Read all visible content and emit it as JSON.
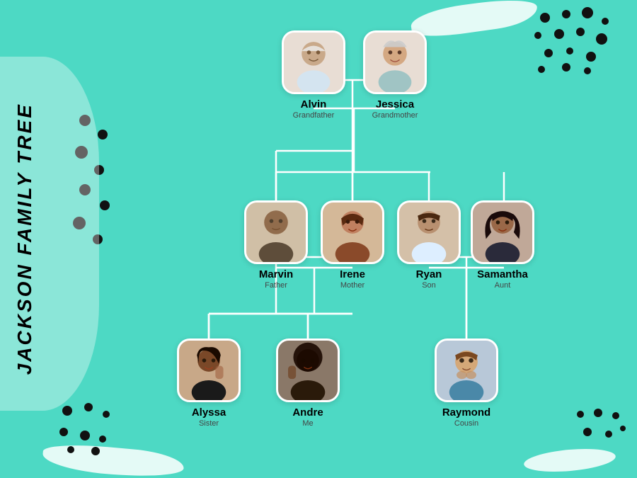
{
  "title": "JACKSON FAMILY TREE",
  "colors": {
    "background": "#4DD9C4",
    "connector": "#ffffff",
    "text_primary": "#000000",
    "text_secondary": "#444444"
  },
  "people": [
    {
      "id": "alvin",
      "name": "Alvin",
      "role": "Grandfather",
      "col": 3,
      "row": 0
    },
    {
      "id": "jessica",
      "name": "Jessica",
      "role": "Grandmother",
      "col": 4,
      "row": 0
    },
    {
      "id": "marvin",
      "name": "Marvin",
      "role": "Father",
      "col": 2,
      "row": 1
    },
    {
      "id": "irene",
      "name": "Irene",
      "role": "Mother",
      "col": 3,
      "row": 1
    },
    {
      "id": "ryan",
      "name": "Ryan",
      "role": "Son",
      "col": 4,
      "row": 1
    },
    {
      "id": "samantha",
      "name": "Samantha",
      "role": "Aunt",
      "col": 5,
      "row": 1
    },
    {
      "id": "alyssa",
      "name": "Alyssa",
      "role": "Sister",
      "col": 2,
      "row": 2
    },
    {
      "id": "andre",
      "name": "Andre",
      "role": "Me",
      "col": 3,
      "row": 2
    },
    {
      "id": "raymond",
      "name": "Raymond",
      "role": "Cousin",
      "col": 5,
      "row": 2
    }
  ]
}
